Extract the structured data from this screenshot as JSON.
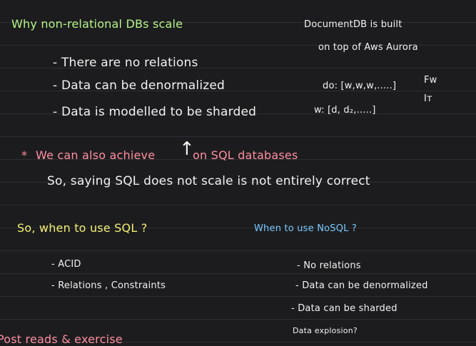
{
  "heading": "Why non-relational DBs scale",
  "reasons": [
    "- There are no relations",
    "- Data can be denormalized",
    "- Data is modelled to be sharded"
  ],
  "side_note": {
    "line1": "DocumentDB is built",
    "line2": "on top of Aws Aurora",
    "line3": "do: [w,w,w,.....]",
    "line4": "w: [d, d₂,.....]",
    "tag1": "Fw",
    "tag2": "Iᴛ"
  },
  "note_line1_star": "*",
  "note_line1_a": "We can also achieve",
  "note_arrow": "↑",
  "note_line1_b": "on SQL databases",
  "note_line2": "So, saying SQL does not scale  is not entirely correct",
  "sql_heading": "So, when to use  SQL ?",
  "sql_items": [
    "- ACID",
    "- Relations , Constraints"
  ],
  "nosql_heading": "When to use  NoSQL ?",
  "nosql_items": [
    "- No relations",
    "- Data can be denormalized",
    "- Data can be sharded"
  ],
  "nosql_extra": "Data explosion?",
  "footer_cut": "Post reads & exercise"
}
